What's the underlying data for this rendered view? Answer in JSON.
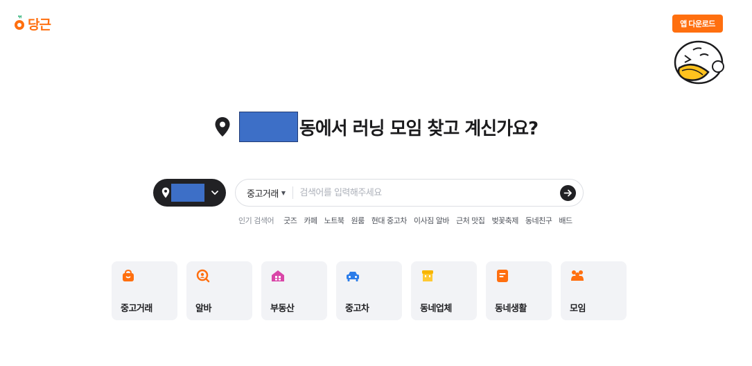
{
  "header": {
    "logo_text": "당근",
    "app_download_label": "앱 다운로드"
  },
  "hero": {
    "title_suffix": "동에서 러닝 모임 찾고 계신가요?"
  },
  "search": {
    "category": "중고거래",
    "placeholder": "검색어를 입력해주세요"
  },
  "popular": {
    "label": "인기 검색어",
    "items": [
      "굿즈",
      "카페",
      "노트북",
      "원룸",
      "현대 중고차",
      "이사짐 알바",
      "근처 맛집",
      "벚꽃축제",
      "동네친구",
      "배드"
    ]
  },
  "categories": [
    {
      "label": "중고거래",
      "icon": "shopping-bag-icon"
    },
    {
      "label": "알바",
      "icon": "job-search-icon"
    },
    {
      "label": "부동산",
      "icon": "house-icon"
    },
    {
      "label": "중고차",
      "icon": "car-icon"
    },
    {
      "label": "동네업체",
      "icon": "store-icon"
    },
    {
      "label": "동네생활",
      "icon": "document-icon"
    },
    {
      "label": "모임",
      "icon": "group-icon"
    }
  ],
  "colors": {
    "brand": "#ff6f0f",
    "redacted": "#3d6fc7",
    "dark": "#212124",
    "card_bg": "#f2f3f6"
  }
}
